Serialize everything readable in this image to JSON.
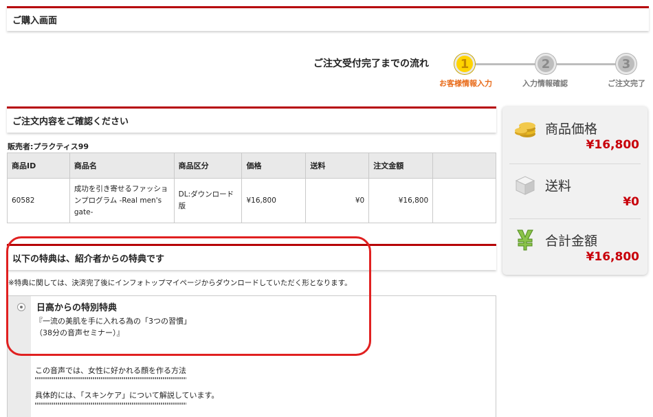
{
  "header": {
    "title": "ご購入画面"
  },
  "flow": {
    "label": "ご注文受付完了までの流れ",
    "steps": [
      {
        "number": "1",
        "label": "お客様情報入力",
        "active": true
      },
      {
        "number": "2",
        "label": "入力情報確認",
        "active": false
      },
      {
        "number": "3",
        "label": "ご注文完了",
        "active": false
      }
    ]
  },
  "confirm": {
    "title": "ご注文内容をご確認ください",
    "seller": "販売者:プラクティス99",
    "columns": [
      "商品ID",
      "商品名",
      "商品区分",
      "価格",
      "送料",
      "注文金額",
      ""
    ],
    "row": {
      "id": "60582",
      "name": "成功を引き寄せるファッションプログラム -Real men's gate-",
      "category": "DL:ダウンロード版",
      "price": "¥16,800",
      "shipping": "¥0",
      "total": "¥16,800"
    }
  },
  "summary": {
    "items": [
      {
        "label": "商品価格",
        "value": "¥16,800",
        "icon": "coins-icon"
      },
      {
        "label": "送料",
        "value": "¥0",
        "icon": "box-icon"
      },
      {
        "label": "合計金額",
        "value": "¥16,800",
        "icon": "yen-icon"
      }
    ]
  },
  "bonus": {
    "title": "以下の特典は、紹介者からの特典です",
    "note": "※特典に関しては、決済完了後にインフォトップマイページからダウンロードしていただく形となります。",
    "item_title": "日高からの特別特典",
    "item_line1": "『一流の美肌を手に入れる為の「3つの習慣」",
    "item_line2": "（38分の音声セミナー）』",
    "desc1": "この音声では、女性に好かれる顔を作る方法",
    "desc2": "具体的には、「スキンケア」について解説しています。"
  },
  "colors": {
    "accent": "#b60005",
    "price": "#c8000a",
    "step_active": "#ffd400",
    "annotation": "#e02020"
  }
}
